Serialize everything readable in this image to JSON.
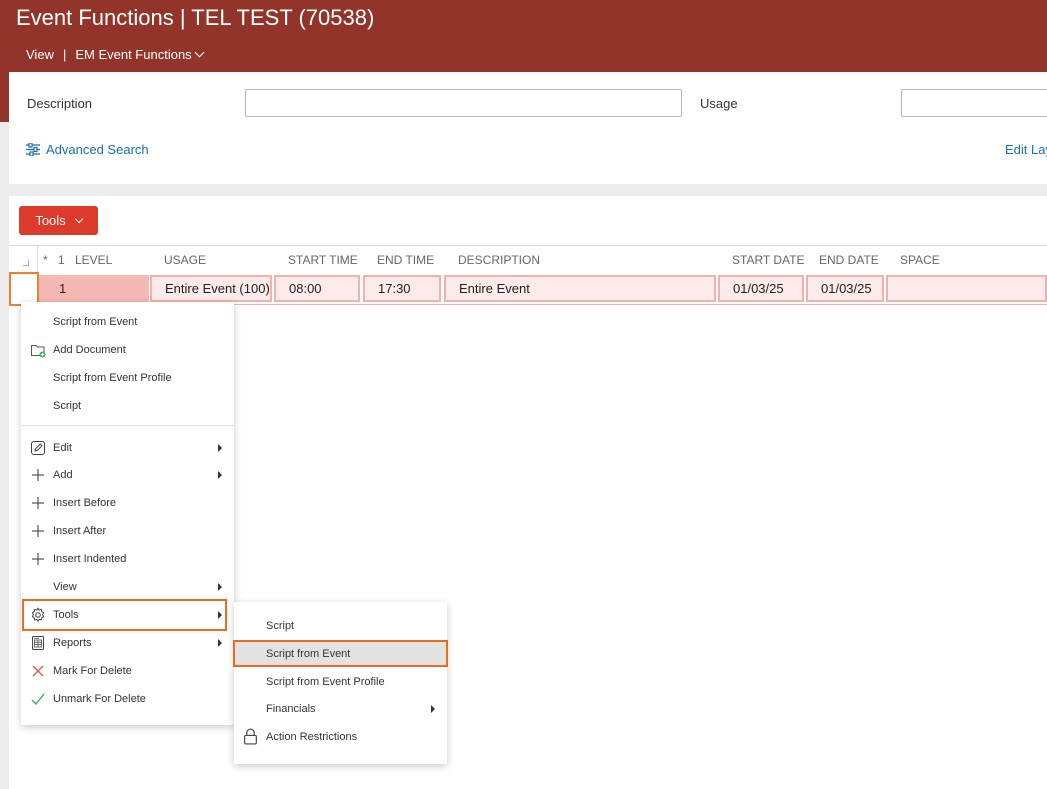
{
  "app": {
    "title": "Event Functions | TEL TEST (70538)",
    "nav_view": "View",
    "nav_separator": "|",
    "nav_functions": "EM Event Functions"
  },
  "search": {
    "description_label": "Description",
    "description_value": "",
    "usage_label": "Usage",
    "usage_value": "",
    "advanced_search": "Advanced Search",
    "edit_layout": "Edit Lay"
  },
  "grid": {
    "tools_button": "Tools",
    "columns": {
      "star": "*",
      "num": "1",
      "level": "LEVEL",
      "usage": "USAGE",
      "start_time": "START TIME",
      "end_time": "END TIME",
      "description": "DESCRIPTION",
      "start_date": "START DATE",
      "end_date": "END DATE",
      "space": "SPACE"
    },
    "row": {
      "level": "1",
      "usage": "Entire Event (100)",
      "start_time": "08:00",
      "end_time": "17:30",
      "description": "Entire Event",
      "start_date": "01/03/25",
      "end_date": "01/03/25",
      "space": ""
    }
  },
  "context_menu": {
    "items": [
      {
        "label": "Script from Event",
        "icon": "none"
      },
      {
        "label": "Add Document",
        "icon": "folder-add-icon"
      },
      {
        "label": "Script from Event Profile",
        "icon": "none"
      },
      {
        "label": "Script",
        "icon": "none"
      },
      {
        "label": "Edit",
        "icon": "edit-icon"
      },
      {
        "label": "Add",
        "icon": "plus-icon"
      },
      {
        "label": "Insert Before",
        "icon": "plus-icon"
      },
      {
        "label": "Insert After",
        "icon": "plus-icon"
      },
      {
        "label": "Insert Indented",
        "icon": "plus-icon"
      },
      {
        "label": "View",
        "icon": "none"
      },
      {
        "label": "Tools",
        "icon": "gear-icon"
      },
      {
        "label": "Reports",
        "icon": "report-icon"
      },
      {
        "label": "Mark For Delete",
        "icon": "x-icon"
      },
      {
        "label": "Unmark For Delete",
        "icon": "check-icon"
      }
    ]
  },
  "submenu": {
    "items": [
      {
        "label": "Script"
      },
      {
        "label": "Script from Event"
      },
      {
        "label": "Script from Event Profile"
      },
      {
        "label": "Financials"
      },
      {
        "label": "Action Restrictions",
        "icon": "lock-icon"
      }
    ]
  },
  "colors": {
    "header_bg": "#923429",
    "tools_button": "#dc3b2c",
    "link": "#1a6fb0",
    "highlight": "#f06a1d",
    "row_bg": "#fdeaea",
    "delete_x": "#e05a4a",
    "check": "#3aaa5a"
  }
}
